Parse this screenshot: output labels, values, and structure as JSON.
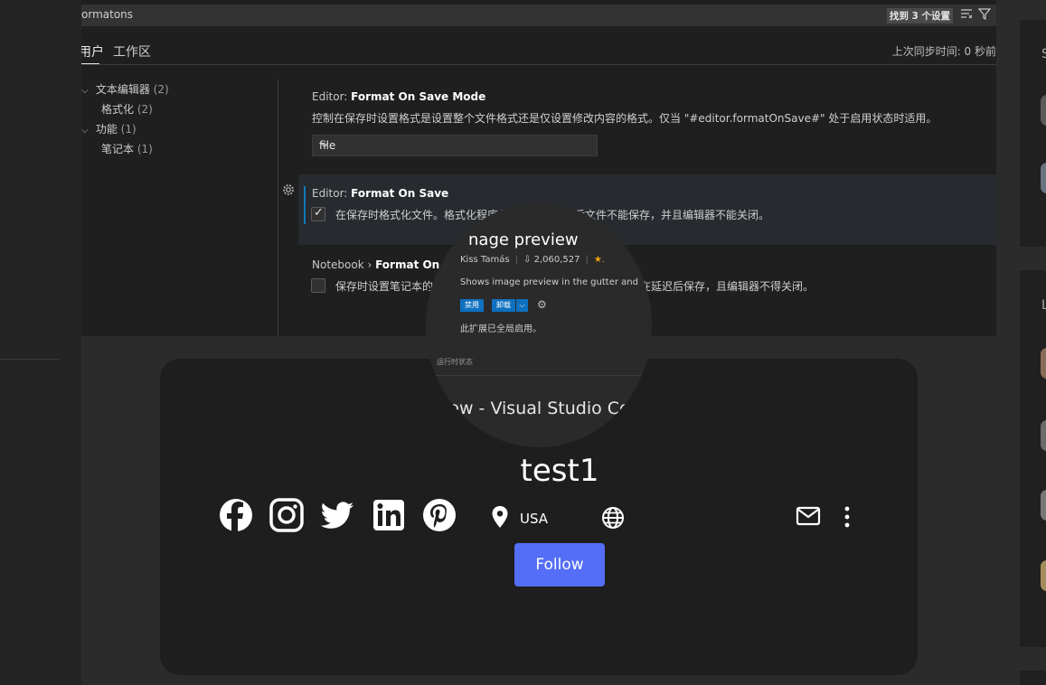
{
  "vscode": {
    "search_text": "ormatons",
    "found_badge": "找到 3 个设置",
    "tab_user": "用户",
    "tab_workspace": "工作区",
    "sync_time": "上次同步时间: 0 秒前",
    "tree": {
      "text_editor": "文本编辑器",
      "text_editor_count": "(2)",
      "formatting": "格式化",
      "formatting_count": "(2)",
      "features": "功能",
      "features_count": "(1)",
      "notebook": "笔记本",
      "notebook_count": "(1)"
    },
    "settings": {
      "s1_prefix": "Editor: ",
      "s1_name": "Format On Save Mode",
      "s1_desc": "控制在保存时设置格式是设置整个文件格式还是仅设置修改内容的格式。仅当 \"#editor.formatOnSave#\" 处于启用状态时适用。",
      "s1_value": "file",
      "s2_prefix": "Editor: ",
      "s2_name": "Format On Save",
      "s2_desc": "在保存时格式化文件。格式化程序必须可用，延迟后文件不能保存，并且编辑器不能关闭。",
      "s2_checked": true,
      "s3_prefix": "Notebook › ",
      "s3_name": "Format On Sav",
      "s3_desc_start": "保存时设置笔记本的",
      "s3_desc_end": "在延迟后保存，且编辑器不得关闭。",
      "s3_checked": false
    }
  },
  "magnifier": {
    "title": "nage preview",
    "author": "Kiss Tamás",
    "downloads": "2,060,527",
    "rating": "★.",
    "description": "Shows image preview in the gutter and",
    "btn_disable": "禁用",
    "btn_uninstall": "卸载",
    "enabled_text": "此扩展已全局启用。",
    "runtime_tab": "运行时状态",
    "window_title": "iew - Visual Studio Co"
  },
  "profile": {
    "name": "test1",
    "location": "USA",
    "follow_label": "Follow",
    "social_icons": [
      "facebook-icon",
      "instagram-icon",
      "twitter-icon",
      "linkedin-icon",
      "pinterest-icon"
    ]
  },
  "right_panel": {
    "letter_s": "S",
    "letter_l": "L"
  },
  "colors": {
    "follow_button": "#546ef7",
    "accent_blue": "#0e70c0",
    "star": "#f0a30a"
  }
}
